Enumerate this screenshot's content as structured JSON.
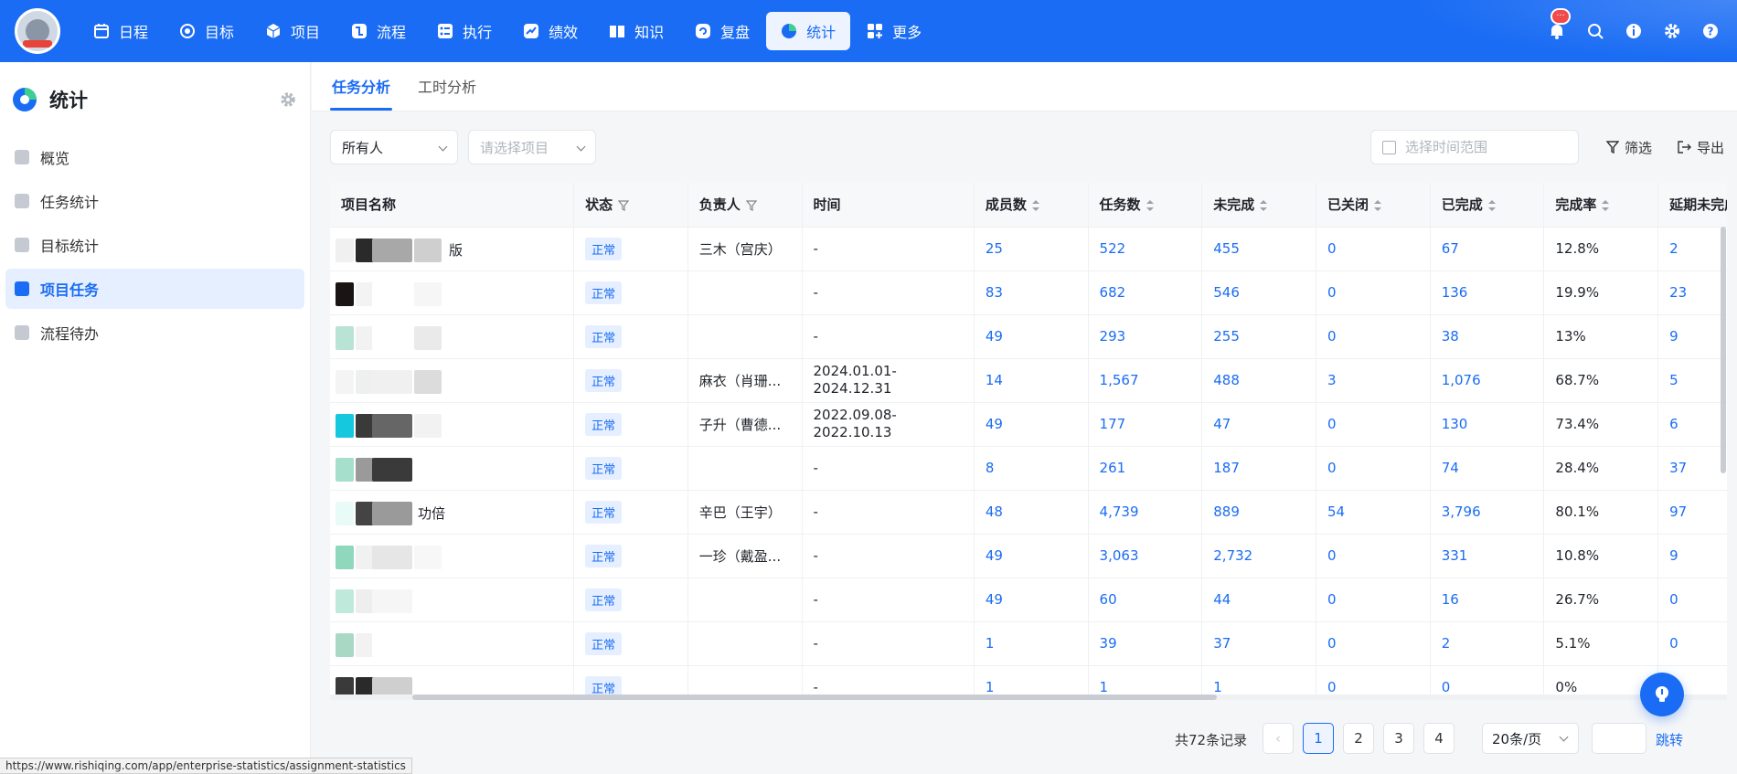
{
  "nav": {
    "items": [
      {
        "label": "日程",
        "icon": "calendar-icon"
      },
      {
        "label": "目标",
        "icon": "target-icon"
      },
      {
        "label": "项目",
        "icon": "cube-icon"
      },
      {
        "label": "流程",
        "icon": "flow-icon"
      },
      {
        "label": "执行",
        "icon": "checklist-icon"
      },
      {
        "label": "绩效",
        "icon": "performance-icon"
      },
      {
        "label": "知识",
        "icon": "book-icon"
      },
      {
        "label": "复盘",
        "icon": "review-icon"
      },
      {
        "label": "统计",
        "icon": "pie-chart-icon",
        "active": true
      },
      {
        "label": "更多",
        "icon": "grid-plus-icon"
      }
    ],
    "notification_badge": "···"
  },
  "sidebar": {
    "title": "统计",
    "items": [
      {
        "label": "概览"
      },
      {
        "label": "任务统计"
      },
      {
        "label": "目标统计"
      },
      {
        "label": "项目任务",
        "active": true
      },
      {
        "label": "流程待办"
      }
    ]
  },
  "tabs": [
    {
      "label": "任务分析",
      "active": true
    },
    {
      "label": "工时分析"
    }
  ],
  "filters": {
    "owner_select": "所有人",
    "project_placeholder": "请选择项目",
    "date_placeholder": "选择时间范围",
    "filter_label": "筛选",
    "export_label": "导出"
  },
  "table": {
    "columns": [
      "项目名称",
      "状态",
      "负责人",
      "时间",
      "成员数",
      "任务数",
      "未完成",
      "已关闭",
      "已完成",
      "完成率",
      "延期未完成"
    ],
    "rows": [
      {
        "name_fragment": "版",
        "status": "正常",
        "owner": "三木（宫庆）",
        "time": "-",
        "members": "25",
        "tasks": "522",
        "incomplete": "455",
        "closed": "0",
        "completed": "67",
        "rate": "12.8%",
        "overdue": "2"
      },
      {
        "name_fragment": "",
        "status": "正常",
        "owner": "",
        "time": "-",
        "members": "83",
        "tasks": "682",
        "incomplete": "546",
        "closed": "0",
        "completed": "136",
        "rate": "19.9%",
        "overdue": "23"
      },
      {
        "name_fragment": "",
        "status": "正常",
        "owner": "",
        "time": "-",
        "members": "49",
        "tasks": "293",
        "incomplete": "255",
        "closed": "0",
        "completed": "38",
        "rate": "13%",
        "overdue": "9"
      },
      {
        "name_fragment": "",
        "status": "正常",
        "owner": "麻衣（肖珊...",
        "time": "2024.01.01-2024.12.31",
        "members": "14",
        "tasks": "1,567",
        "incomplete": "488",
        "closed": "3",
        "completed": "1,076",
        "rate": "68.7%",
        "overdue": "5"
      },
      {
        "name_fragment": "",
        "status": "正常",
        "owner": "子升（曹德...",
        "time": "2022.09.08-2022.10.13",
        "members": "49",
        "tasks": "177",
        "incomplete": "47",
        "closed": "0",
        "completed": "130",
        "rate": "73.4%",
        "overdue": "6"
      },
      {
        "name_fragment": "",
        "status": "正常",
        "owner": "",
        "time": "-",
        "members": "8",
        "tasks": "261",
        "incomplete": "187",
        "closed": "0",
        "completed": "74",
        "rate": "28.4%",
        "overdue": "37"
      },
      {
        "name_fragment": "功倍",
        "status": "正常",
        "owner": "辛巴（王宇）",
        "time": "-",
        "members": "48",
        "tasks": "4,739",
        "incomplete": "889",
        "closed": "54",
        "completed": "3,796",
        "rate": "80.1%",
        "overdue": "97"
      },
      {
        "name_fragment": "",
        "status": "正常",
        "owner": "一珍（戴盈...",
        "time": "-",
        "members": "49",
        "tasks": "3,063",
        "incomplete": "2,732",
        "closed": "0",
        "completed": "331",
        "rate": "10.8%",
        "overdue": "9"
      },
      {
        "name_fragment": "",
        "status": "正常",
        "owner": "",
        "time": "-",
        "members": "49",
        "tasks": "60",
        "incomplete": "44",
        "closed": "0",
        "completed": "16",
        "rate": "26.7%",
        "overdue": "0"
      },
      {
        "name_fragment": "",
        "status": "正常",
        "owner": "",
        "time": "-",
        "members": "1",
        "tasks": "39",
        "incomplete": "37",
        "closed": "0",
        "completed": "2",
        "rate": "5.1%",
        "overdue": "0"
      },
      {
        "name_fragment": "",
        "status": "正常",
        "owner": "",
        "time": "-",
        "members": "1",
        "tasks": "1",
        "incomplete": "1",
        "closed": "0",
        "completed": "0",
        "rate": "0%",
        "overdue": ""
      }
    ]
  },
  "pagination": {
    "total": "共72条记录",
    "prev": "‹",
    "pages": [
      "1",
      "2",
      "3",
      "4"
    ],
    "next": "›",
    "page_size": "20条/页",
    "jump_label": "跳转"
  },
  "status_url": "https://www.rishiqing.com/app/enterprise-statistics/assignment-statistics",
  "colors": {
    "primary": "#1a6cf4",
    "status_bg": "#e6efff"
  }
}
